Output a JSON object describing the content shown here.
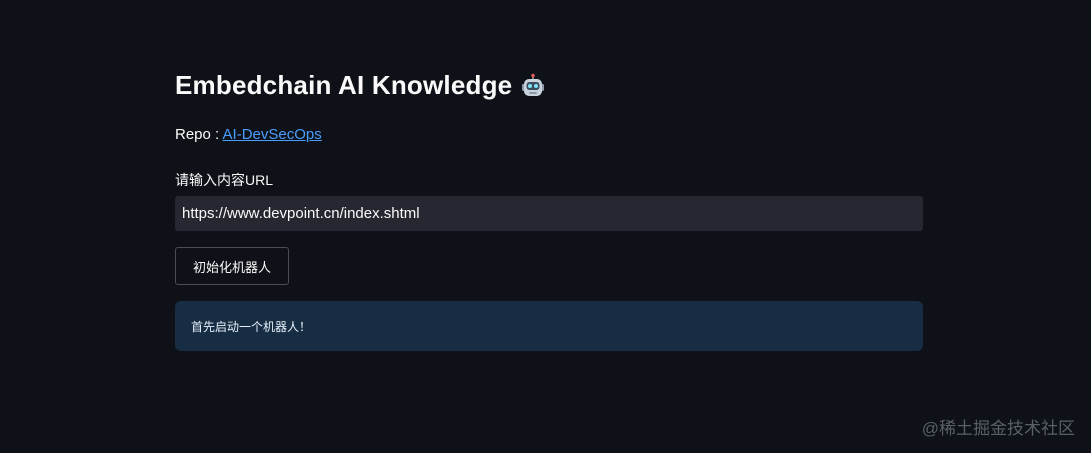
{
  "header": {
    "title": "Embedchain AI Knowledge",
    "title_icon": "robot-icon"
  },
  "repo": {
    "label": "Repo : ",
    "link_text": "AI-DevSecOps"
  },
  "form": {
    "input_label": "请输入内容URL",
    "url_value": "https://www.devpoint.cn/index.shtml",
    "button_label": "初始化机器人"
  },
  "info": {
    "message": "首先启动一个机器人！"
  },
  "watermark": {
    "text": "@稀土掘金技术社区"
  },
  "colors": {
    "background": "#0e1117",
    "input_background": "#262730",
    "info_background": "#172d43",
    "link": "#4a9eff",
    "text": "#fafafa"
  }
}
